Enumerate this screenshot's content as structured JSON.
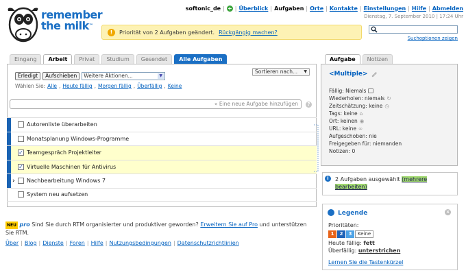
{
  "logo": {
    "line1": "remember",
    "line2": "the milk",
    "tm": "™"
  },
  "topnav": {
    "user": "softonic_de",
    "items": [
      "Überblick",
      "Aufgaben",
      "Orte",
      "Kontakte",
      "Einstellungen",
      "Hilfe",
      "Abmelden"
    ],
    "current": "Aufgaben",
    "datetime": "Dienstag, 7. September 2010 | 17:24 Uhr"
  },
  "message": {
    "text": "Priorität von 2 Aufgaben geändert.",
    "undo": "Rückgängig machen?"
  },
  "search": {
    "options": "Suchoptionen zeigen"
  },
  "tabs": [
    "Eingang",
    "Arbeit",
    "Privat",
    "Studium",
    "Gesendet",
    "Alle Aufgaben"
  ],
  "toolbar": {
    "done": "Erledigt",
    "postpone": "Aufschieben",
    "more": "Weitere Aktionen...",
    "sort": "Sortieren nach..."
  },
  "select": {
    "label": "Wählen Sie:",
    "options": [
      "Alle",
      "Heute fällig",
      "Morgen fällig",
      "Überfällig",
      "Keine"
    ]
  },
  "addtask": {
    "placeholder": "« Eine neue Aufgabe hinzufügen"
  },
  "tasks": [
    {
      "label": "Autorenliste überarbeiten",
      "priority": 1,
      "checked": false
    },
    {
      "label": "Monatsplanung Windows-Programme",
      "priority": 1,
      "checked": false
    },
    {
      "label": "Teamgespräch Projektleiter",
      "priority": 1,
      "checked": true
    },
    {
      "label": "Virtuelle Maschinen für Antivirus",
      "priority": 1,
      "checked": true
    },
    {
      "label": "Nachbearbeitung Windows 7",
      "priority": 1,
      "checked": false
    },
    {
      "label": "System neu aufsetzen",
      "priority": 0,
      "checked": false
    }
  ],
  "promo": {
    "new": "NEU",
    "pro": "pro",
    "text1": "Sind Sie durch RTM organisierter und produktiver geworden?",
    "link": "Erweitern Sie auf Pro",
    "text2": "und unterstützen Sie RTM."
  },
  "footer": [
    "Über",
    "Blog",
    "Dienste",
    "Foren",
    "Hilfe",
    "Nutzungsbedingungen",
    "Datenschutzrichtlinien"
  ],
  "rtabs": [
    "Aufgabe",
    "Notizen"
  ],
  "details": {
    "title": "<Multiple>",
    "props": [
      "Fällig: Niemals",
      "Wiederholen: niemals",
      "Zeitschätzung: keine",
      "Tags: keine",
      "Ort: keinen",
      "URL: keine",
      "Aufgeschoben: nie",
      "Freigegeben für: niemanden",
      "Notizen: 0"
    ]
  },
  "info": {
    "text": "2 Aufgaben ausgewählt",
    "link": "(mehrere bearbeiten)"
  },
  "legend": {
    "title": "Legende",
    "prio_label": "Prioritäten:",
    "prio": [
      "1",
      "2",
      "3",
      "Keine"
    ],
    "due_today_label": "Heute fällig:",
    "due_today_value": "fett",
    "overdue_label": "Überfällig:",
    "overdue_value": "unterstrichen",
    "shortcuts": "Lernen Sie die Tastenkürzel"
  },
  "colors": {
    "brand": "#1a6fc4",
    "prio1": "#e8641b",
    "prio2": "#1f63b8",
    "prio3": "#4fa3e6"
  }
}
